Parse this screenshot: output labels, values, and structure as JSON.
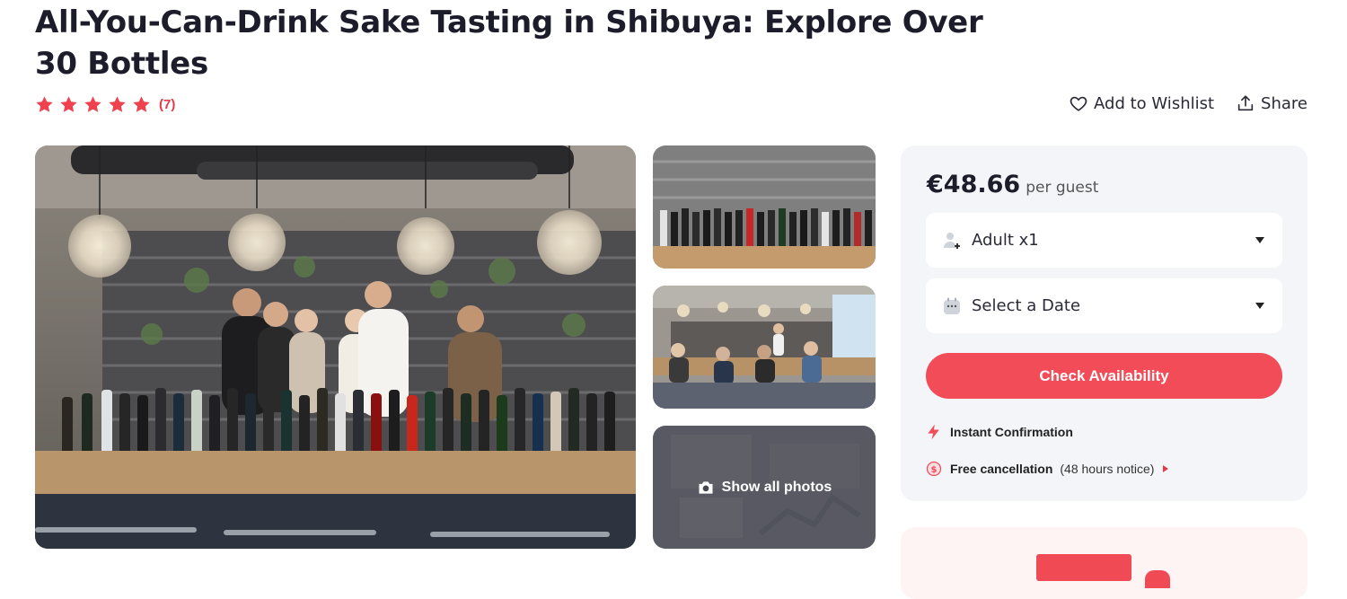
{
  "page": {
    "title": "All-You-Can-Drink Sake Tasting in Shibuya: Explore Over 30 Bottles",
    "rating": {
      "stars": 5,
      "review_count": "(7)"
    },
    "actions": {
      "wishlist": "Add to Wishlist",
      "share": "Share"
    }
  },
  "gallery": {
    "show_all": "Show all photos"
  },
  "booking": {
    "price": "€48.66",
    "per_guest": "per guest",
    "guests_select": "Adult x1",
    "date_select": "Select a Date",
    "check_button": "Check Availability",
    "instant_confirmation": "Instant Confirmation",
    "free_cancellation": "Free cancellation",
    "cancellation_note": "(48 hours notice)"
  },
  "colors": {
    "accent": "#f24c58",
    "star": "#f0414f",
    "panel": "#f4f5f9"
  },
  "icons": [
    "star-icon",
    "heart-icon",
    "share-icon",
    "camera-icon",
    "user-plus-icon",
    "calendar-icon",
    "bolt-icon",
    "dollar-icon",
    "caret-down-icon"
  ]
}
